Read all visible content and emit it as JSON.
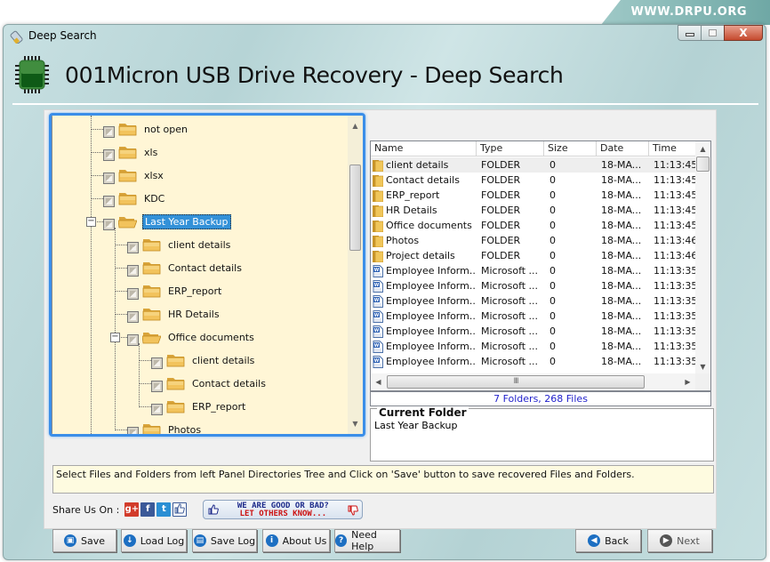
{
  "banner": {
    "text": "WWW.DRPU.ORG"
  },
  "window": {
    "title": "Deep Search",
    "controls": {
      "minimize": "minimize",
      "maximize": "maximize",
      "close": "X"
    }
  },
  "header": {
    "app_title": "001Micron USB Drive Recovery - Deep Search",
    "icon": "chip-icon"
  },
  "tree": {
    "items": [
      {
        "label": "not open",
        "level": 1,
        "selected": false,
        "expanded": null
      },
      {
        "label": "xls",
        "level": 1,
        "selected": false,
        "expanded": null
      },
      {
        "label": "xlsx",
        "level": 1,
        "selected": false,
        "expanded": null
      },
      {
        "label": "KDC",
        "level": 1,
        "selected": false,
        "expanded": null
      },
      {
        "label": "Last Year Backup",
        "level": 1,
        "selected": true,
        "expanded": true
      },
      {
        "label": "client details",
        "level": 2,
        "selected": false,
        "expanded": null
      },
      {
        "label": "Contact details",
        "level": 2,
        "selected": false,
        "expanded": null
      },
      {
        "label": "ERP_report",
        "level": 2,
        "selected": false,
        "expanded": null
      },
      {
        "label": "HR Details",
        "level": 2,
        "selected": false,
        "expanded": null
      },
      {
        "label": "Office documents",
        "level": 2,
        "selected": false,
        "expanded": true
      },
      {
        "label": "client details",
        "level": 3,
        "selected": false,
        "expanded": null
      },
      {
        "label": "Contact details",
        "level": 3,
        "selected": false,
        "expanded": null
      },
      {
        "label": "ERP_report",
        "level": 3,
        "selected": false,
        "expanded": null
      },
      {
        "label": "Photos",
        "level": 2,
        "selected": false,
        "expanded": null
      }
    ]
  },
  "file_list": {
    "columns": [
      "Name",
      "Type",
      "Size",
      "Date",
      "Time"
    ],
    "rows": [
      {
        "icon": "folder-icon",
        "name": "client details",
        "type": "FOLDER",
        "size": "0",
        "date": "18-MA...",
        "time": "11:13:45"
      },
      {
        "icon": "folder-icon",
        "name": "Contact details",
        "type": "FOLDER",
        "size": "0",
        "date": "18-MA...",
        "time": "11:13:45"
      },
      {
        "icon": "folder-icon",
        "name": "ERP_report",
        "type": "FOLDER",
        "size": "0",
        "date": "18-MA...",
        "time": "11:13:45"
      },
      {
        "icon": "folder-icon",
        "name": "HR Details",
        "type": "FOLDER",
        "size": "0",
        "date": "18-MA...",
        "time": "11:13:45"
      },
      {
        "icon": "folder-icon",
        "name": "Office documents",
        "type": "FOLDER",
        "size": "0",
        "date": "18-MA...",
        "time": "11:13:45"
      },
      {
        "icon": "folder-icon",
        "name": "Photos",
        "type": "FOLDER",
        "size": "0",
        "date": "18-MA...",
        "time": "11:13:46"
      },
      {
        "icon": "folder-icon",
        "name": "Project details",
        "type": "FOLDER",
        "size": "0",
        "date": "18-MA...",
        "time": "11:13:46"
      },
      {
        "icon": "word-doc-icon",
        "name": "Employee Inform...",
        "type": "Microsoft ...",
        "size": "0",
        "date": "18-MA...",
        "time": "11:13:35"
      },
      {
        "icon": "word-doc-icon",
        "name": "Employee Inform...",
        "type": "Microsoft ...",
        "size": "0",
        "date": "18-MA...",
        "time": "11:13:35"
      },
      {
        "icon": "word-doc-icon",
        "name": "Employee Inform...",
        "type": "Microsoft ...",
        "size": "0",
        "date": "18-MA...",
        "time": "11:13:35"
      },
      {
        "icon": "word-doc-icon",
        "name": "Employee Inform...",
        "type": "Microsoft ...",
        "size": "0",
        "date": "18-MA...",
        "time": "11:13:35"
      },
      {
        "icon": "word-doc-icon",
        "name": "Employee Inform...",
        "type": "Microsoft ...",
        "size": "0",
        "date": "18-MA...",
        "time": "11:13:35"
      },
      {
        "icon": "word-doc-icon",
        "name": "Employee Inform...",
        "type": "Microsoft ...",
        "size": "0",
        "date": "18-MA...",
        "time": "11:13:35"
      },
      {
        "icon": "word-doc-icon",
        "name": "Employee Inform...",
        "type": "Microsoft ...",
        "size": "0",
        "date": "18-MA...",
        "time": "11:13:35"
      }
    ],
    "summary": "7 Folders, 268 Files",
    "hscroll_grip": "III"
  },
  "current_folder": {
    "legend": "Current Folder",
    "value": "Last Year Backup"
  },
  "hint": "Select Files and Folders from left Panel Directories Tree and Click on 'Save' button to save recovered Files and Folders.",
  "share": {
    "label": "Share Us On :",
    "icons": [
      {
        "name": "google-plus-icon",
        "glyph": "g+",
        "color": "#d23b2a"
      },
      {
        "name": "facebook-icon",
        "glyph": "f",
        "color": "#3b5998"
      },
      {
        "name": "twitter-icon",
        "glyph": "t",
        "color": "#2b8fd4"
      },
      {
        "name": "like-icon",
        "glyph": "👍",
        "color": "#ffffff"
      }
    ],
    "feedback_line1": "WE ARE GOOD OR BAD?",
    "feedback_line2": "LET OTHERS KNOW..."
  },
  "buttons": {
    "save": "Save",
    "load_log": "Load Log",
    "save_log": "Save Log",
    "about_us": "About Us",
    "need_help": "Need Help",
    "back": "Back",
    "next": "Next"
  },
  "colors": {
    "accent_blue": "#3b8ee8",
    "selection": "#3391d8",
    "tree_background": "#fff6d6",
    "hint_background": "#fefbe0",
    "summary_text": "#2222cc"
  }
}
